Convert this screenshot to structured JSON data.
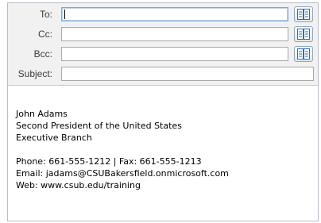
{
  "compose": {
    "fields": [
      {
        "id": "to",
        "label": "To:",
        "value": "",
        "has_address_book": true
      },
      {
        "id": "cc",
        "label": "Cc:",
        "value": "",
        "has_address_book": true
      },
      {
        "id": "bcc",
        "label": "Bcc:",
        "value": "",
        "has_address_book": true
      },
      {
        "id": "subject",
        "label": "Subject:",
        "value": "",
        "has_address_book": false
      }
    ]
  },
  "signature": {
    "name": "John Adams",
    "title": "Second President of the United States",
    "department": "Executive Branch",
    "phone_fax": "Phone: 661-555-1212 | Fax: 661-555-1213",
    "email": "Email: jadams@CSUBakersfield.onmicrosoft.com",
    "web": "Web: www.csub.edu/training"
  },
  "colors": {
    "header_bg": "#f1f1f1",
    "field_border": "#a9a9a9",
    "focus_border": "#7aa7d8",
    "address_book_icon": "#2a6db5"
  }
}
